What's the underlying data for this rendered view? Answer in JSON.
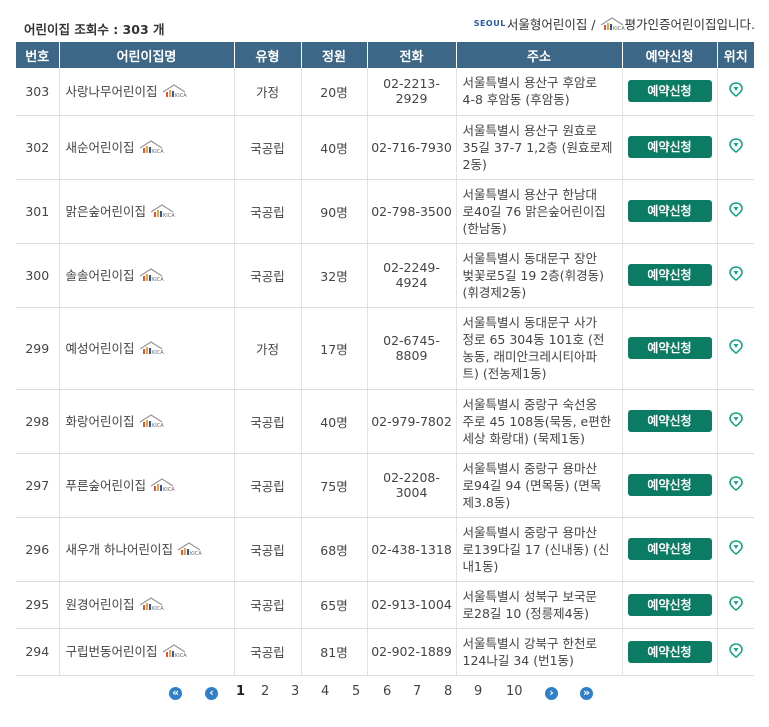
{
  "header": {
    "count_text": "어린이집 조회수 : 303 개",
    "seoul_mark": "SEOUL",
    "legend_seoul": "서울형어린이집 /",
    "legend_kicac": "평가인증어린이집입니다."
  },
  "columns": [
    "번호",
    "어린이집명",
    "유형",
    "정원",
    "전화",
    "주소",
    "예약신청",
    "위치"
  ],
  "rows": [
    {
      "no": "303",
      "name": "사랑나무어린이집",
      "type": "가정",
      "cap": "20명",
      "tel": "02-2213-2929",
      "addr": [
        "서울특별시 용산구 후암로",
        "4-8 후암동 (후암동)"
      ],
      "btn": "예약신청"
    },
    {
      "no": "302",
      "name": "새순어린이집",
      "type": "국공립",
      "cap": "40명",
      "tel": "02-716-7930",
      "addr": [
        "서울특별시 용산구 원효로",
        "35길 37-7 1,2층 (원효로제",
        "2동)"
      ],
      "btn": "예약신청"
    },
    {
      "no": "301",
      "name": "맑은숲어린이집",
      "type": "국공립",
      "cap": "90명",
      "tel": "02-798-3500",
      "addr": [
        "서울특별시 용산구 한남대",
        "로40길 76 맑은숲어린이집",
        "(한남동)"
      ],
      "btn": "예약신청"
    },
    {
      "no": "300",
      "name": "솔솔어린이집",
      "type": "국공립",
      "cap": "32명",
      "tel": "02-2249-4924",
      "addr": [
        "서울특별시 동대문구 장안",
        "벚꽃로5길 19 2층(휘경동)",
        "(휘경제2동)"
      ],
      "btn": "예약신청"
    },
    {
      "no": "299",
      "name": "예성어린이집",
      "type": "가정",
      "cap": "17명",
      "tel": "02-6745-8809",
      "addr": [
        "서울특별시 동대문구 사가",
        "정로 65 304동 101호 (전",
        "농동, 래미안크레시티아파",
        "트) (전농제1동)"
      ],
      "btn": "예약신청"
    },
    {
      "no": "298",
      "name": "화랑어린이집",
      "type": "국공립",
      "cap": "40명",
      "tel": "02-979-7802",
      "addr": [
        "서울특별시 중랑구 숙선옹",
        "주로 45 108동(묵동, e편한",
        "세상 화랑대) (묵제1동)"
      ],
      "btn": "예약신청"
    },
    {
      "no": "297",
      "name": "푸른숲어린이집",
      "type": "국공립",
      "cap": "75명",
      "tel": "02-2208-3004",
      "addr": [
        "서울특별시 중랑구 용마산",
        "로94길 94 (면목동) (면목",
        "제3.8동)"
      ],
      "btn": "예약신청"
    },
    {
      "no": "296",
      "name": "새우개 하나어린이집",
      "type": "국공립",
      "cap": "68명",
      "tel": "02-438-1318",
      "addr": [
        "서울특별시 중랑구 용마산",
        "로139다길 17 (신내동) (신",
        "내1동)"
      ],
      "btn": "예약신청"
    },
    {
      "no": "295",
      "name": "원경어린이집",
      "type": "국공립",
      "cap": "65명",
      "tel": "02-913-1004",
      "addr": [
        "서울특별시 성북구 보국문",
        "로28길 10 (정릉제4동)"
      ],
      "btn": "예약신청"
    },
    {
      "no": "294",
      "name": "구립번동어린이집",
      "type": "국공립",
      "cap": "81명",
      "tel": "02-902-1889",
      "addr": [
        "서울특별시 강북구 한천로",
        "124나길 34 (번1동)"
      ],
      "btn": "예약신청"
    }
  ],
  "pagination": {
    "pages": [
      "1",
      "2",
      "3",
      "4",
      "5",
      "6",
      "7",
      "8",
      "9",
      "10"
    ],
    "current": "1"
  },
  "colors": {
    "header": "#3d6787",
    "button": "#0b7c63",
    "pager": "#2f80c8",
    "pin": "#1aa58a"
  }
}
